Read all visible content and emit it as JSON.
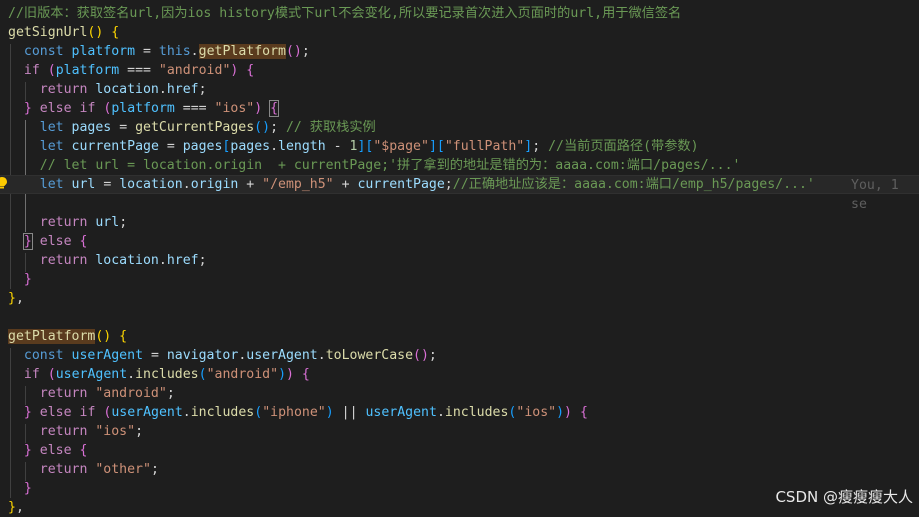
{
  "editor": {
    "lines": [
      [
        {
          "t": "//旧版本：获取签名url,因为ios history模式下url不会变化,所以要记录首次进入页面时的url,用于微信签名",
          "c": "c"
        }
      ],
      [
        {
          "t": "getSignUrl",
          "c": "f"
        },
        {
          "t": "() ",
          "c": "p1"
        },
        {
          "t": "{",
          "c": "p1"
        }
      ],
      [
        {
          "t": "  "
        },
        {
          "t": "const",
          "c": "k"
        },
        {
          "t": " "
        },
        {
          "t": "platform",
          "c": "v"
        },
        {
          "t": " = "
        },
        {
          "t": "this",
          "c": "k"
        },
        {
          "t": "."
        },
        {
          "t": "getPlatform",
          "c": "f hl"
        },
        {
          "t": "()",
          "c": "p2"
        },
        {
          "t": ";"
        }
      ],
      [
        {
          "t": "  "
        },
        {
          "t": "if",
          "c": "cf"
        },
        {
          "t": " "
        },
        {
          "t": "(",
          "c": "p2"
        },
        {
          "t": "platform",
          "c": "v"
        },
        {
          "t": " === "
        },
        {
          "t": "\"android\"",
          "c": "s"
        },
        {
          "t": ")",
          "c": "p2"
        },
        {
          "t": " "
        },
        {
          "t": "{",
          "c": "p2"
        }
      ],
      [
        {
          "t": "    "
        },
        {
          "t": "return",
          "c": "cf"
        },
        {
          "t": " "
        },
        {
          "t": "location",
          "c": "i"
        },
        {
          "t": "."
        },
        {
          "t": "href",
          "c": "i"
        },
        {
          "t": ";"
        }
      ],
      [
        {
          "t": "  "
        },
        {
          "t": "}",
          "c": "p2"
        },
        {
          "t": " "
        },
        {
          "t": "else",
          "c": "cf"
        },
        {
          "t": " "
        },
        {
          "t": "if",
          "c": "cf"
        },
        {
          "t": " "
        },
        {
          "t": "(",
          "c": "p2"
        },
        {
          "t": "platform",
          "c": "v"
        },
        {
          "t": " === "
        },
        {
          "t": "\"ios\"",
          "c": "s"
        },
        {
          "t": ")",
          "c": "p2"
        },
        {
          "t": " "
        },
        {
          "t": "{",
          "c": "p2 br"
        }
      ],
      [
        {
          "t": "    "
        },
        {
          "t": "let",
          "c": "k"
        },
        {
          "t": " "
        },
        {
          "t": "pages",
          "c": "i"
        },
        {
          "t": " = "
        },
        {
          "t": "getCurrentPages",
          "c": "f"
        },
        {
          "t": "()",
          "c": "p3"
        },
        {
          "t": "; "
        },
        {
          "t": "// 获取栈实例",
          "c": "c"
        }
      ],
      [
        {
          "t": "    "
        },
        {
          "t": "let",
          "c": "k"
        },
        {
          "t": " "
        },
        {
          "t": "currentPage",
          "c": "i"
        },
        {
          "t": " = "
        },
        {
          "t": "pages",
          "c": "i"
        },
        {
          "t": "[",
          "c": "p3"
        },
        {
          "t": "pages",
          "c": "i"
        },
        {
          "t": "."
        },
        {
          "t": "length",
          "c": "i"
        },
        {
          "t": " - "
        },
        {
          "t": "1",
          "c": "n"
        },
        {
          "t": "]",
          "c": "p3"
        },
        {
          "t": "[",
          "c": "p3"
        },
        {
          "t": "\"$page\"",
          "c": "s"
        },
        {
          "t": "]",
          "c": "p3"
        },
        {
          "t": "[",
          "c": "p3"
        },
        {
          "t": "\"fullPath\"",
          "c": "s"
        },
        {
          "t": "]",
          "c": "p3"
        },
        {
          "t": "; "
        },
        {
          "t": "//当前页面路径(带参数)",
          "c": "c"
        }
      ],
      [
        {
          "t": "    "
        },
        {
          "t": "// let url = location.origin  + currentPage;'拼了拿到的地址是错的为：aaaa.com:端口/pages/...'",
          "c": "c"
        }
      ],
      [
        {
          "t": "    "
        },
        {
          "t": "let",
          "c": "k"
        },
        {
          "t": " "
        },
        {
          "t": "url",
          "c": "i"
        },
        {
          "t": " = "
        },
        {
          "t": "location",
          "c": "i"
        },
        {
          "t": "."
        },
        {
          "t": "origin",
          "c": "i"
        },
        {
          "t": " + "
        },
        {
          "t": "\"/emp_h5\"",
          "c": "s"
        },
        {
          "t": " + "
        },
        {
          "t": "currentPage",
          "c": "i"
        },
        {
          "t": ";"
        },
        {
          "t": "//正确地址应该是：aaaa.com:端口/emp_h5/pages/...'",
          "c": "c"
        }
      ],
      [],
      [
        {
          "t": "    "
        },
        {
          "t": "return",
          "c": "cf"
        },
        {
          "t": " "
        },
        {
          "t": "url",
          "c": "i"
        },
        {
          "t": ";"
        }
      ],
      [
        {
          "t": "  "
        },
        {
          "t": "}",
          "c": "p2 br"
        },
        {
          "t": " "
        },
        {
          "t": "else",
          "c": "cf"
        },
        {
          "t": " "
        },
        {
          "t": "{",
          "c": "p2"
        }
      ],
      [
        {
          "t": "    "
        },
        {
          "t": "return",
          "c": "cf"
        },
        {
          "t": " "
        },
        {
          "t": "location",
          "c": "i"
        },
        {
          "t": "."
        },
        {
          "t": "href",
          "c": "i"
        },
        {
          "t": ";"
        }
      ],
      [
        {
          "t": "  "
        },
        {
          "t": "}",
          "c": "p2"
        }
      ],
      [
        {
          "t": "}",
          "c": "p1"
        },
        {
          "t": ","
        }
      ],
      [],
      [
        {
          "t": "getPlatform",
          "c": "f hl"
        },
        {
          "t": "() ",
          "c": "p1"
        },
        {
          "t": "{",
          "c": "p1"
        }
      ],
      [
        {
          "t": "  "
        },
        {
          "t": "const",
          "c": "k"
        },
        {
          "t": " "
        },
        {
          "t": "userAgent",
          "c": "v"
        },
        {
          "t": " = "
        },
        {
          "t": "navigator",
          "c": "i"
        },
        {
          "t": "."
        },
        {
          "t": "userAgent",
          "c": "i"
        },
        {
          "t": "."
        },
        {
          "t": "toLowerCase",
          "c": "f"
        },
        {
          "t": "()",
          "c": "p2"
        },
        {
          "t": ";"
        }
      ],
      [
        {
          "t": "  "
        },
        {
          "t": "if",
          "c": "cf"
        },
        {
          "t": " "
        },
        {
          "t": "(",
          "c": "p2"
        },
        {
          "t": "userAgent",
          "c": "v"
        },
        {
          "t": "."
        },
        {
          "t": "includes",
          "c": "f"
        },
        {
          "t": "(",
          "c": "p3"
        },
        {
          "t": "\"android\"",
          "c": "s"
        },
        {
          "t": ")",
          "c": "p3"
        },
        {
          "t": ")",
          "c": "p2"
        },
        {
          "t": " "
        },
        {
          "t": "{",
          "c": "p2"
        }
      ],
      [
        {
          "t": "    "
        },
        {
          "t": "return",
          "c": "cf"
        },
        {
          "t": " "
        },
        {
          "t": "\"android\"",
          "c": "s"
        },
        {
          "t": ";"
        }
      ],
      [
        {
          "t": "  "
        },
        {
          "t": "}",
          "c": "p2"
        },
        {
          "t": " "
        },
        {
          "t": "else",
          "c": "cf"
        },
        {
          "t": " "
        },
        {
          "t": "if",
          "c": "cf"
        },
        {
          "t": " "
        },
        {
          "t": "(",
          "c": "p2"
        },
        {
          "t": "userAgent",
          "c": "v"
        },
        {
          "t": "."
        },
        {
          "t": "includes",
          "c": "f"
        },
        {
          "t": "(",
          "c": "p3"
        },
        {
          "t": "\"iphone\"",
          "c": "s"
        },
        {
          "t": ")",
          "c": "p3"
        },
        {
          "t": " || "
        },
        {
          "t": "userAgent",
          "c": "v"
        },
        {
          "t": "."
        },
        {
          "t": "includes",
          "c": "f"
        },
        {
          "t": "(",
          "c": "p3"
        },
        {
          "t": "\"ios\"",
          "c": "s"
        },
        {
          "t": ")",
          "c": "p3"
        },
        {
          "t": ")",
          "c": "p2"
        },
        {
          "t": " "
        },
        {
          "t": "{",
          "c": "p2"
        }
      ],
      [
        {
          "t": "    "
        },
        {
          "t": "return",
          "c": "cf"
        },
        {
          "t": " "
        },
        {
          "t": "\"ios\"",
          "c": "s"
        },
        {
          "t": ";"
        }
      ],
      [
        {
          "t": "  "
        },
        {
          "t": "}",
          "c": "p2"
        },
        {
          "t": " "
        },
        {
          "t": "else",
          "c": "cf"
        },
        {
          "t": " "
        },
        {
          "t": "{",
          "c": "p2"
        }
      ],
      [
        {
          "t": "    "
        },
        {
          "t": "return",
          "c": "cf"
        },
        {
          "t": " "
        },
        {
          "t": "\"other\"",
          "c": "s"
        },
        {
          "t": ";"
        }
      ],
      [
        {
          "t": "  "
        },
        {
          "t": "}",
          "c": "p2"
        }
      ],
      [
        {
          "t": "}",
          "c": "p1"
        },
        {
          "t": ","
        }
      ]
    ],
    "blame_text": "You, 1 se",
    "colors": {
      "background": "#1e1e1e",
      "comment": "#6a9955",
      "function": "#dcdcaa",
      "keyword": "#569cd6",
      "control": "#c586c0",
      "string": "#ce9178",
      "variable": "#9cdcfe",
      "constant": "#4fc1ff",
      "number": "#b5cea8"
    }
  },
  "watermark": "CSDN @瘦瘦瘦大人"
}
